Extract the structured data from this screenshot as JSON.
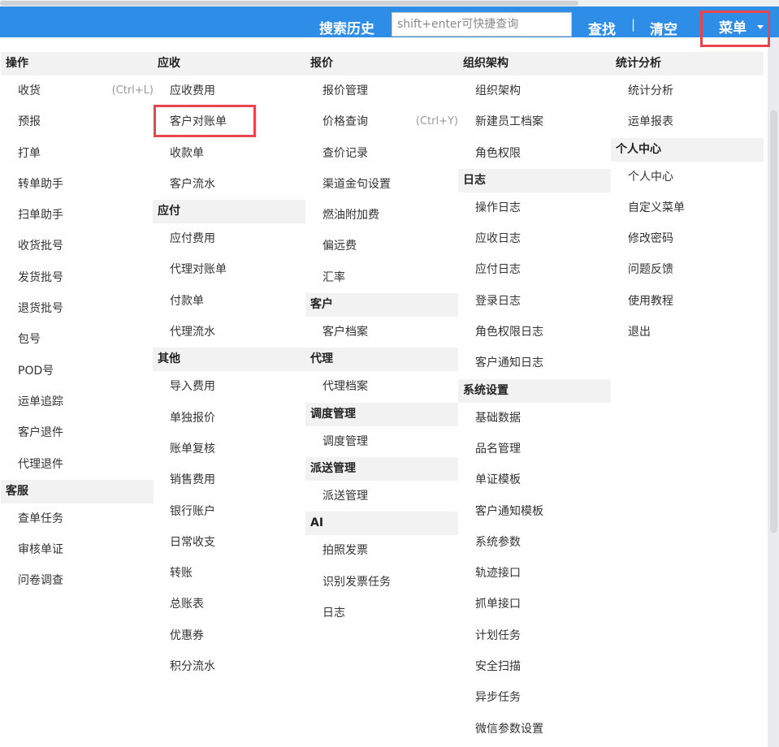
{
  "topbar": {
    "search_history_label": "搜索历史",
    "search_placeholder": "shift+enter可快捷查询",
    "find_label": "查找",
    "separator": "|",
    "clear_label": "清空",
    "menu_label": "菜单"
  },
  "columns": [
    {
      "groups": [
        {
          "title": "操作",
          "items": [
            {
              "label": "收货",
              "shortcut": "(Ctrl+L)"
            },
            {
              "label": "预报"
            },
            {
              "label": "打单"
            },
            {
              "label": "转单助手"
            },
            {
              "label": "扫单助手"
            },
            {
              "label": "收货批号"
            },
            {
              "label": "发货批号"
            },
            {
              "label": "退货批号"
            },
            {
              "label": "包号"
            },
            {
              "label": "POD号"
            },
            {
              "label": "运单追踪"
            },
            {
              "label": "客户退件"
            },
            {
              "label": "代理退件"
            }
          ]
        },
        {
          "title": "客服",
          "items": [
            {
              "label": "查单任务"
            },
            {
              "label": "审核单证"
            },
            {
              "label": "问卷调查"
            }
          ]
        }
      ]
    },
    {
      "groups": [
        {
          "title": "应收",
          "items": [
            {
              "label": "应收费用"
            },
            {
              "label": "客户对账单"
            },
            {
              "label": "收款单"
            },
            {
              "label": "客户流水"
            }
          ]
        },
        {
          "title": "应付",
          "items": [
            {
              "label": "应付费用"
            },
            {
              "label": "代理对账单"
            },
            {
              "label": "付款单"
            },
            {
              "label": "代理流水"
            }
          ]
        },
        {
          "title": "其他",
          "items": [
            {
              "label": "导入费用"
            },
            {
              "label": "单独报价"
            },
            {
              "label": "账单复核"
            },
            {
              "label": "销售费用"
            },
            {
              "label": "银行账户"
            },
            {
              "label": "日常收支"
            },
            {
              "label": "转账"
            },
            {
              "label": "总账表"
            },
            {
              "label": "优惠券"
            },
            {
              "label": "积分流水"
            }
          ]
        }
      ]
    },
    {
      "groups": [
        {
          "title": "报价",
          "items": [
            {
              "label": "报价管理"
            },
            {
              "label": "价格查询",
              "shortcut": "(Ctrl+Y)"
            },
            {
              "label": "查价记录"
            },
            {
              "label": "渠道金句设置"
            },
            {
              "label": "燃油附加费"
            },
            {
              "label": "偏远费"
            },
            {
              "label": "汇率"
            }
          ]
        },
        {
          "title": "客户",
          "items": [
            {
              "label": "客户档案"
            }
          ]
        },
        {
          "title": "代理",
          "items": [
            {
              "label": "代理档案"
            }
          ]
        },
        {
          "title": "调度管理",
          "items": [
            {
              "label": "调度管理"
            }
          ]
        },
        {
          "title": "派送管理",
          "items": [
            {
              "label": "派送管理"
            }
          ]
        },
        {
          "title": "AI",
          "items": [
            {
              "label": "拍照发票"
            },
            {
              "label": "识别发票任务"
            },
            {
              "label": "日志"
            }
          ]
        }
      ]
    },
    {
      "groups": [
        {
          "title": "组织架构",
          "items": [
            {
              "label": "组织架构"
            },
            {
              "label": "新建员工档案"
            },
            {
              "label": "角色权限"
            }
          ]
        },
        {
          "title": "日志",
          "items": [
            {
              "label": "操作日志"
            },
            {
              "label": "应收日志"
            },
            {
              "label": "应付日志"
            },
            {
              "label": "登录日志"
            },
            {
              "label": "角色权限日志"
            },
            {
              "label": "客户通知日志"
            }
          ]
        },
        {
          "title": "系统设置",
          "items": [
            {
              "label": "基础数据"
            },
            {
              "label": "品名管理"
            },
            {
              "label": "单证模板"
            },
            {
              "label": "客户通知模板"
            },
            {
              "label": "系统参数"
            },
            {
              "label": "轨迹接口"
            },
            {
              "label": "抓单接口"
            },
            {
              "label": "计划任务"
            },
            {
              "label": "安全扫描"
            },
            {
              "label": "异步任务"
            },
            {
              "label": "微信参数设置"
            }
          ]
        }
      ]
    },
    {
      "groups": [
        {
          "title": "统计分析",
          "items": [
            {
              "label": "统计分析"
            },
            {
              "label": "运单报表"
            }
          ]
        },
        {
          "title": "个人中心",
          "items": [
            {
              "label": "个人中心"
            },
            {
              "label": "自定义菜单"
            },
            {
              "label": "修改密码"
            },
            {
              "label": "问题反馈"
            },
            {
              "label": "使用教程"
            },
            {
              "label": "退出"
            }
          ]
        }
      ]
    }
  ],
  "colors": {
    "topbar_bg": "#2e8de6",
    "highlight": "#e8454f",
    "group_bg": "#f2f2f2"
  }
}
